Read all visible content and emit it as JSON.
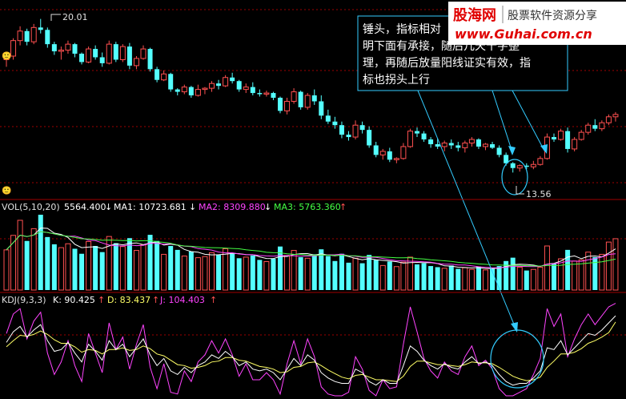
{
  "watermark": {
    "site_cn": "股海网",
    "slogan": "股票软件资源分享",
    "url": "www.Guhai.com.cn"
  },
  "annotation": {
    "lines": [
      "锤头，指标相对",
      "明下面有承接，随后几天十字整",
      "理，再随后放量阳线证实有效，指",
      "标也拐头上行"
    ]
  },
  "price_panel": {
    "high_label": "20.01",
    "low_label": "13.56",
    "corner_mark": "🙂"
  },
  "vol_panel": {
    "title": "VOL(5,10,20)",
    "vol_value": "5564.400",
    "ma1_label": "MA1: 10723.681",
    "ma2_label": "MA2: 8309.880",
    "ma3_label": "MA3: 5763.360"
  },
  "kdj_panel": {
    "title": "KDJ(9,3,3)",
    "k_label": "K: 90.425",
    "d_label": "D: 83.437",
    "j_label": "J: 104.403"
  },
  "colors": {
    "up": "#ff5050",
    "down": "#54ffff",
    "ma1": "#ffffff",
    "ma2": "#ff44ff",
    "ma3": "#44ff44",
    "kline": "#ffffff",
    "dline": "#ffff66",
    "jline": "#ff44ff",
    "grid": "#a00000",
    "circle": "#33ccff"
  },
  "chart_data": {
    "type": "candlestick",
    "price_range": [
      13.0,
      20.3
    ],
    "ohlc": [
      [
        18.3,
        18.6,
        18.0,
        18.45
      ],
      [
        18.45,
        19.2,
        18.3,
        19.1
      ],
      [
        19.1,
        19.7,
        18.9,
        19.5
      ],
      [
        19.5,
        19.6,
        18.9,
        19.05
      ],
      [
        19.05,
        19.8,
        18.95,
        19.65
      ],
      [
        19.65,
        20.01,
        19.4,
        19.55
      ],
      [
        19.55,
        19.65,
        18.8,
        18.95
      ],
      [
        18.95,
        19.05,
        18.5,
        18.65
      ],
      [
        18.65,
        18.85,
        18.3,
        18.7
      ],
      [
        18.7,
        19.1,
        18.55,
        18.95
      ],
      [
        18.95,
        19.0,
        18.4,
        18.55
      ],
      [
        18.55,
        18.6,
        18.1,
        18.2
      ],
      [
        18.2,
        18.85,
        18.15,
        18.75
      ],
      [
        18.75,
        18.9,
        18.3,
        18.4
      ],
      [
        18.4,
        18.6,
        18.0,
        18.15
      ],
      [
        18.15,
        19.1,
        18.1,
        18.95
      ],
      [
        18.95,
        19.05,
        18.2,
        18.3
      ],
      [
        18.3,
        18.95,
        18.2,
        18.85
      ],
      [
        18.85,
        19.0,
        17.9,
        18.05
      ],
      [
        18.05,
        18.45,
        17.9,
        18.35
      ],
      [
        18.35,
        18.9,
        18.3,
        18.75
      ],
      [
        18.75,
        18.8,
        17.8,
        17.9
      ],
      [
        17.9,
        18.0,
        17.35,
        17.45
      ],
      [
        17.45,
        17.85,
        17.4,
        17.7
      ],
      [
        17.7,
        17.75,
        16.95,
        17.05
      ],
      [
        17.05,
        17.1,
        16.8,
        16.95
      ],
      [
        16.95,
        17.25,
        16.85,
        17.15
      ],
      [
        17.15,
        17.2,
        16.7,
        16.8
      ],
      [
        16.8,
        17.25,
        16.75,
        17.05
      ],
      [
        17.05,
        17.15,
        16.85,
        17.1
      ],
      [
        17.1,
        17.4,
        16.95,
        17.3
      ],
      [
        17.3,
        17.45,
        17.05,
        17.2
      ],
      [
        17.2,
        17.65,
        17.15,
        17.55
      ],
      [
        17.55,
        17.75,
        17.3,
        17.4
      ],
      [
        17.4,
        17.45,
        16.95,
        17.05
      ],
      [
        17.05,
        17.3,
        16.9,
        17.15
      ],
      [
        17.15,
        17.35,
        16.8,
        16.9
      ],
      [
        16.9,
        17.05,
        16.75,
        16.85
      ],
      [
        16.85,
        17.0,
        16.75,
        16.9
      ],
      [
        16.9,
        16.95,
        16.6,
        16.7
      ],
      [
        16.7,
        16.75,
        16.05,
        16.15
      ],
      [
        16.15,
        16.7,
        16.0,
        16.55
      ],
      [
        16.55,
        17.1,
        16.45,
        16.95
      ],
      [
        16.95,
        17.0,
        16.2,
        16.3
      ],
      [
        16.3,
        16.9,
        16.2,
        16.8
      ],
      [
        16.8,
        17.05,
        16.4,
        16.55
      ],
      [
        16.55,
        16.8,
        15.8,
        15.95
      ],
      [
        15.95,
        16.2,
        15.6,
        15.7
      ],
      [
        15.7,
        15.9,
        15.4,
        15.55
      ],
      [
        15.55,
        15.7,
        15.0,
        15.15
      ],
      [
        15.15,
        15.3,
        14.9,
        15.05
      ],
      [
        15.05,
        15.75,
        14.95,
        15.55
      ],
      [
        15.55,
        15.7,
        15.2,
        15.35
      ],
      [
        15.35,
        15.5,
        14.6,
        14.7
      ],
      [
        14.7,
        14.85,
        14.2,
        14.3
      ],
      [
        14.3,
        14.55,
        14.1,
        14.45
      ],
      [
        14.45,
        14.6,
        14.0,
        14.1
      ],
      [
        14.1,
        14.2,
        13.95,
        14.15
      ],
      [
        14.15,
        14.8,
        14.1,
        14.65
      ],
      [
        14.65,
        15.4,
        14.6,
        15.3
      ],
      [
        15.3,
        15.45,
        15.05,
        15.2
      ],
      [
        15.2,
        15.3,
        14.85,
        14.95
      ],
      [
        14.95,
        15.05,
        14.6,
        14.75
      ],
      [
        14.75,
        15.0,
        14.55,
        14.65
      ],
      [
        14.65,
        14.9,
        14.45,
        14.8
      ],
      [
        14.8,
        14.95,
        14.55,
        14.7
      ],
      [
        14.7,
        14.85,
        14.45,
        14.6
      ],
      [
        14.6,
        14.9,
        14.4,
        14.8
      ],
      [
        14.8,
        15.05,
        14.65,
        14.95
      ],
      [
        14.95,
        15.0,
        14.55,
        14.65
      ],
      [
        14.65,
        14.8,
        14.5,
        14.75
      ],
      [
        14.75,
        14.85,
        14.55,
        14.6
      ],
      [
        14.6,
        14.7,
        14.2,
        14.3
      ],
      [
        14.3,
        14.4,
        13.85,
        13.95
      ],
      [
        13.95,
        14.0,
        13.56,
        13.75
      ],
      [
        13.75,
        13.9,
        13.6,
        13.85
      ],
      [
        13.85,
        13.95,
        13.7,
        13.8
      ],
      [
        13.8,
        14.05,
        13.7,
        13.9
      ],
      [
        13.9,
        14.25,
        13.85,
        14.15
      ],
      [
        14.15,
        15.2,
        14.1,
        15.05
      ],
      [
        15.05,
        15.2,
        14.85,
        14.95
      ],
      [
        14.95,
        15.4,
        14.9,
        15.3
      ],
      [
        15.3,
        15.45,
        14.4,
        14.55
      ],
      [
        14.55,
        15.05,
        14.45,
        14.95
      ],
      [
        14.95,
        15.35,
        14.9,
        15.25
      ],
      [
        15.25,
        15.65,
        15.15,
        15.55
      ],
      [
        15.55,
        15.8,
        15.3,
        15.4
      ],
      [
        15.4,
        15.75,
        15.3,
        15.65
      ],
      [
        15.65,
        16.0,
        15.55,
        15.9
      ],
      [
        15.9,
        16.1,
        15.7,
        16.0
      ]
    ],
    "volume": [
      7200,
      9800,
      12500,
      8800,
      11000,
      13500,
      9500,
      8200,
      7600,
      8300,
      7400,
      6500,
      8700,
      7900,
      6800,
      9600,
      8400,
      7800,
      9300,
      7100,
      8100,
      9900,
      8800,
      6400,
      7900,
      7200,
      6100,
      6900,
      5800,
      6000,
      6700,
      6300,
      7400,
      6500,
      5700,
      5900,
      6200,
      5400,
      5100,
      5600,
      7800,
      6200,
      7100,
      5900,
      5700,
      6400,
      7300,
      6100,
      5200,
      6500,
      4900,
      5700,
      4800,
      6300,
      5400,
      4400,
      5100,
      4200,
      5000,
      5900,
      4600,
      4800,
      4300,
      4100,
      3900,
      4400,
      3800,
      4000,
      3700,
      4200,
      3600,
      3800,
      4300,
      5200,
      5800,
      4100,
      3500,
      3700,
      4100,
      7900,
      4700,
      5600,
      7200,
      5200,
      5400,
      6800,
      5900,
      6400,
      8600,
      9200
    ],
    "kdj": {
      "k": [
        60,
        72,
        78,
        66,
        74,
        80,
        62,
        50,
        52,
        60,
        48,
        38,
        58,
        50,
        40,
        62,
        52,
        58,
        44,
        54,
        64,
        46,
        34,
        42,
        28,
        24,
        32,
        26,
        34,
        38,
        46,
        42,
        50,
        44,
        34,
        38,
        30,
        28,
        30,
        26,
        18,
        30,
        42,
        34,
        46,
        40,
        26,
        20,
        16,
        14,
        14,
        30,
        26,
        16,
        12,
        18,
        14,
        14,
        34,
        56,
        50,
        40,
        34,
        30,
        36,
        32,
        30,
        38,
        44,
        36,
        38,
        34,
        24,
        16,
        12,
        14,
        14,
        20,
        28,
        54,
        52,
        62,
        46,
        54,
        62,
        70,
        68,
        74,
        82,
        90
      ],
      "d": [
        55,
        62,
        68,
        67,
        69,
        73,
        69,
        63,
        59,
        59,
        55,
        49,
        52,
        51,
        47,
        52,
        52,
        54,
        51,
        52,
        56,
        53,
        47,
        45,
        40,
        35,
        34,
        31,
        32,
        34,
        38,
        39,
        43,
        43,
        40,
        39,
        36,
        33,
        32,
        30,
        26,
        27,
        32,
        33,
        37,
        38,
        34,
        29,
        25,
        21,
        19,
        23,
        24,
        21,
        18,
        18,
        17,
        16,
        22,
        33,
        39,
        39,
        37,
        35,
        35,
        34,
        33,
        35,
        38,
        37,
        37,
        36,
        32,
        27,
        22,
        19,
        17,
        18,
        21,
        32,
        39,
        47,
        47,
        49,
        53,
        59,
        62,
        66,
        71,
        83
      ],
      "j": [
        70,
        92,
        98,
        64,
        84,
        94,
        48,
        24,
        38,
        62,
        34,
        16,
        70,
        48,
        26,
        82,
        52,
        66,
        30,
        58,
        80,
        32,
        8,
        36,
        4,
        2,
        28,
        16,
        38,
        46,
        62,
        48,
        64,
        46,
        22,
        36,
        18,
        18,
        26,
        18,
        2,
        36,
        62,
        36,
        64,
        44,
        10,
        2,
        0,
        0,
        4,
        44,
        30,
        6,
        0,
        18,
        8,
        10,
        58,
        100,
        72,
        42,
        28,
        20,
        38,
        28,
        24,
        44,
        56,
        34,
        40,
        30,
        8,
        0,
        0,
        4,
        8,
        24,
        42,
        98,
        78,
        92,
        44,
        64,
        80,
        92,
        80,
        90,
        100,
        104
      ]
    }
  }
}
